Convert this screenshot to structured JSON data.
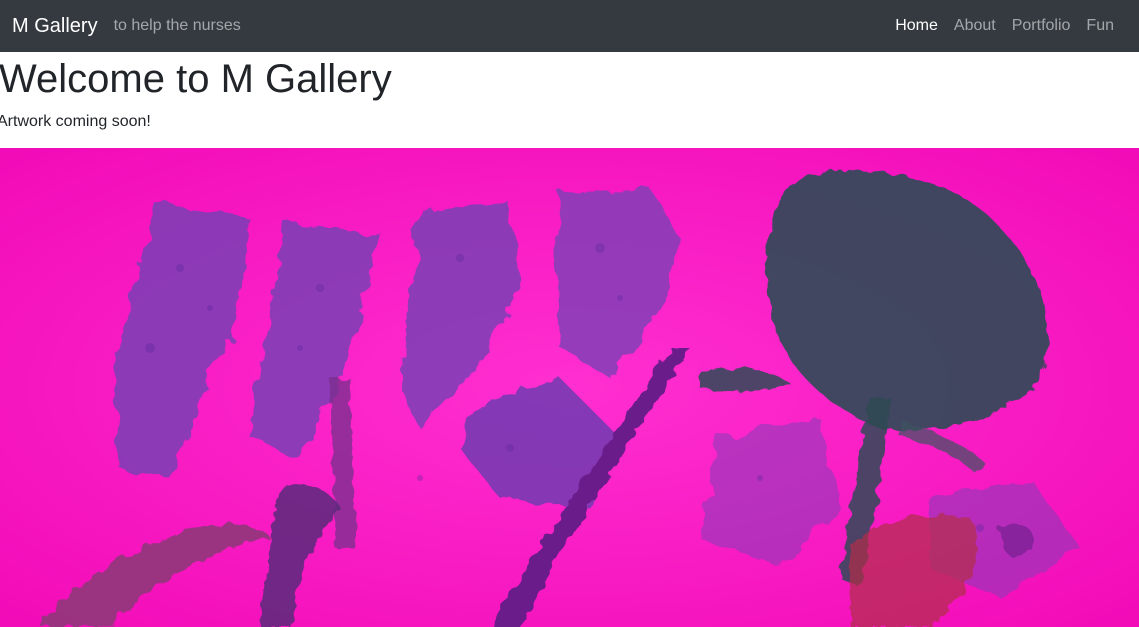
{
  "navbar": {
    "brand": "M Gallery",
    "tagline": "to help the nurses",
    "links": [
      {
        "label": "Home",
        "active": true
      },
      {
        "label": "About",
        "active": false
      },
      {
        "label": "Portfolio",
        "active": false
      },
      {
        "label": "Fun",
        "active": false
      }
    ]
  },
  "main": {
    "title": "Welcome to M Gallery",
    "subtitle": "Artwork coming soon!"
  },
  "artwork": {
    "description_icon": "abstract-painting",
    "colors": {
      "background": "#ff13c6",
      "purple": "#7a3fb5",
      "dark": "#2f4a55",
      "deep_purple": "#6a1f8a"
    }
  }
}
